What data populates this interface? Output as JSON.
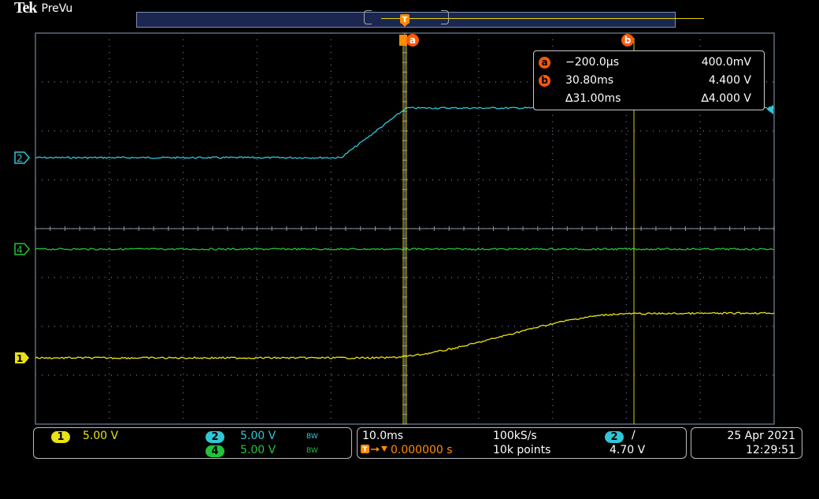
{
  "header": {
    "brand": "Tek",
    "mode": "PreVu"
  },
  "colors": {
    "ch1": "#e9e214",
    "ch2": "#2fc7d7",
    "ch4": "#23c23a",
    "cursor": "#ff5a00",
    "cursor_line": "#d8d000",
    "graticule": "#5e6a7a"
  },
  "markers": {
    "ch2": "2",
    "ch4": "4",
    "ch1": "1",
    "trigger_top": "T",
    "cursor_a": "a",
    "cursor_b": "b"
  },
  "cursor_readout": {
    "a_time": "−200.0µs",
    "a_value": "400.0mV",
    "b_time": "30.80ms",
    "b_value": "4.400 V",
    "delta_time": "∆31.00ms",
    "delta_value": "∆4.000 V"
  },
  "vertical": {
    "ch1": {
      "label": "1",
      "scale": "5.00 V"
    },
    "ch2": {
      "label": "2",
      "scale": "5.00 V",
      "bw": "BW"
    },
    "ch4": {
      "label": "4",
      "scale": "5.00 V",
      "bw": "BW"
    }
  },
  "horizontal": {
    "timebase": "10.0ms",
    "sample_rate": "100kS/s",
    "trigger_delay": "0.000000 s",
    "record_length": "10k points",
    "trigger_source": "2",
    "trigger_slope": "/",
    "trigger_level": "4.70 V"
  },
  "datetime": {
    "date": "25 Apr  2021",
    "time": "12:29:51"
  }
}
